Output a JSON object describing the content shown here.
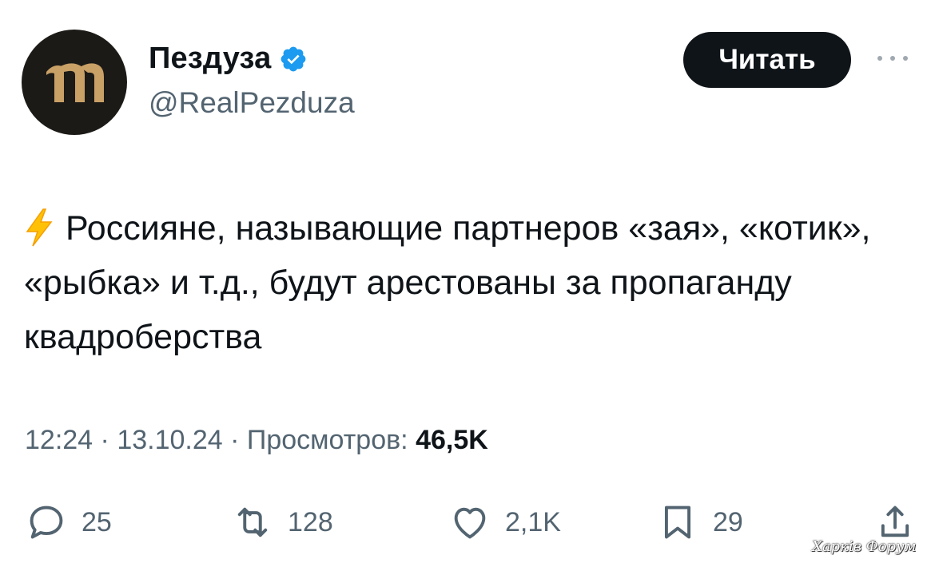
{
  "tweet": {
    "author": {
      "display_name": "Пездуза",
      "handle": "@RealPezduza",
      "verified": true,
      "avatar_icon": "pezduza-logo-icon"
    },
    "follow_label": "Читать",
    "more_icon": "more-dots-icon",
    "emoji": "⚡",
    "text": "Россияне, называющие партнеров «зая», «котик», «рыбка» и т.д., будут арестованы за пропаганду квадроберства",
    "time": "12:24",
    "separator": "·",
    "date": "13.10.24",
    "views_label": "Просмотров:",
    "views_count": "46,5K"
  },
  "actions": {
    "replies": {
      "icon": "reply-icon",
      "count": "25"
    },
    "retweets": {
      "icon": "retweet-icon",
      "count": "128"
    },
    "likes": {
      "icon": "heart-icon",
      "count": "2,1K"
    },
    "bookmarks": {
      "icon": "bookmark-icon",
      "count": "29"
    },
    "share": {
      "icon": "share-icon"
    }
  },
  "watermark": "Харків Форум",
  "colors": {
    "text": "#0f1419",
    "secondary": "#536471",
    "verified": "#1d9bf0",
    "button_bg": "#0f1419",
    "bolt": "#ffc107"
  }
}
